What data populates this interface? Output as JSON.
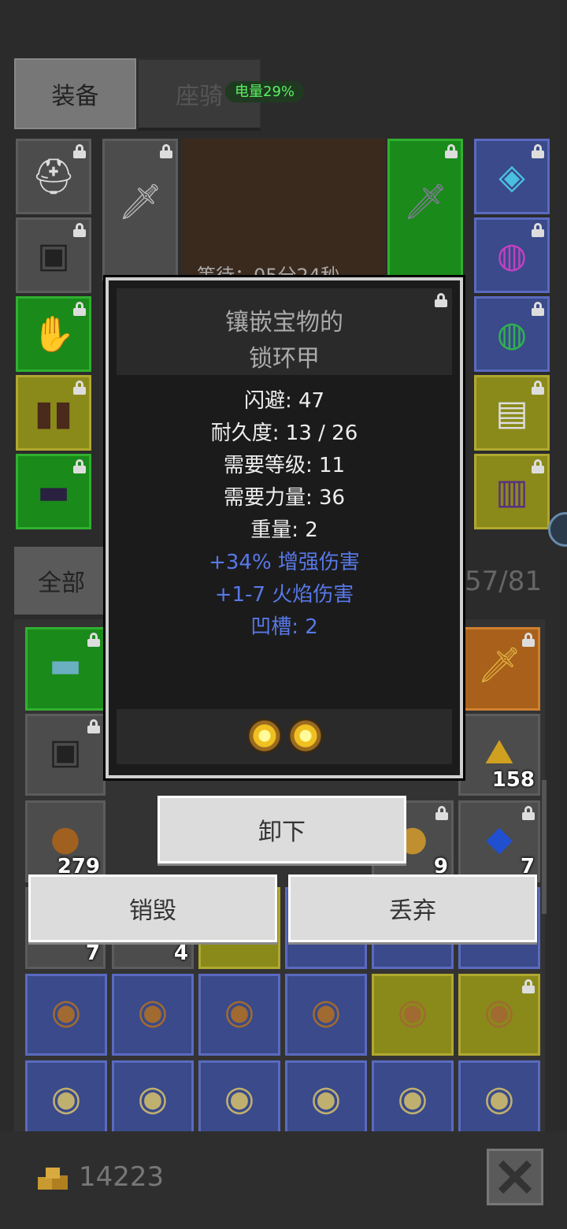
{
  "tabs": {
    "equipment": "装备",
    "mount": "座骑"
  },
  "battery": "电量29%",
  "timer_text": "等待：05分24秒",
  "filter": {
    "all": "全部",
    "capacity": "57/81"
  },
  "tooltip": {
    "title_line1": "镶嵌宝物的",
    "title_line2": "锁环甲",
    "stats": [
      {
        "text": "闪避: 47",
        "type": "base"
      },
      {
        "text": "耐久度: 13 / 26",
        "type": "base"
      },
      {
        "text": "需要等级: 11",
        "type": "base"
      },
      {
        "text": "需要力量: 36",
        "type": "base"
      },
      {
        "text": "重量: 2",
        "type": "base"
      },
      {
        "text": "+34% 增强伤害",
        "type": "magic"
      },
      {
        "text": "+1-7 火焰伤害",
        "type": "magic"
      },
      {
        "text": "凹槽: 2",
        "type": "magic"
      }
    ]
  },
  "buttons": {
    "unequip": "卸下",
    "destroy": "销毁",
    "discard": "丢弃"
  },
  "stack_counts": {
    "c158": "158",
    "c279": "279",
    "c9": "9",
    "c7a": "7",
    "c7b": "7",
    "c4": "4"
  },
  "gold": "14223",
  "colors": {
    "magic": "#5878e8",
    "battery_text": "#5cf064"
  }
}
